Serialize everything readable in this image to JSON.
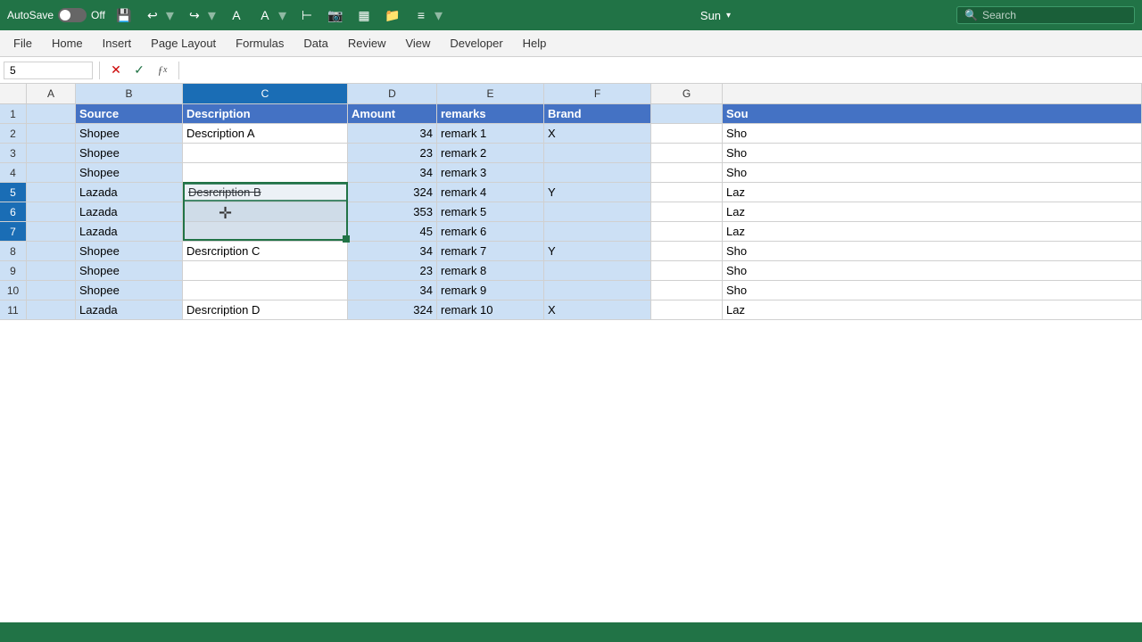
{
  "titleBar": {
    "autosave_label": "AutoSave",
    "toggle_state": "Off",
    "profile": "Sun",
    "search_placeholder": "Search"
  },
  "menuBar": {
    "items": [
      "File",
      "Home",
      "Insert",
      "Page Layout",
      "Formulas",
      "Data",
      "Review",
      "View",
      "Developer",
      "Help"
    ]
  },
  "formulaBar": {
    "cell_ref": "5",
    "formula": ""
  },
  "columns": {
    "letters": [
      "A",
      "B",
      "C",
      "D",
      "E",
      "F",
      "G"
    ],
    "partial_right": "Sou"
  },
  "rows": [
    {
      "num": "1",
      "cells": [
        "",
        "Source",
        "Description",
        "Amount",
        "remarks",
        "Brand",
        ""
      ]
    },
    {
      "num": "2",
      "cells": [
        "",
        "Shopee",
        "Description A",
        "34",
        "remark 1",
        "X",
        "Sho"
      ]
    },
    {
      "num": "3",
      "cells": [
        "",
        "Shopee",
        "",
        "23",
        "remark 2",
        "",
        "Sho"
      ]
    },
    {
      "num": "4",
      "cells": [
        "",
        "Shopee",
        "",
        "34",
        "remark 3",
        "",
        "Sho"
      ]
    },
    {
      "num": "5",
      "cells": [
        "",
        "Lazada",
        "Desrcription B",
        "324",
        "remark 4",
        "Y",
        "Laz"
      ]
    },
    {
      "num": "6",
      "cells": [
        "",
        "Lazada",
        "",
        "353",
        "remark 5",
        "",
        "Laz"
      ]
    },
    {
      "num": "7",
      "cells": [
        "",
        "Lazada",
        "",
        "45",
        "remark 6",
        "",
        "Laz"
      ]
    },
    {
      "num": "8",
      "cells": [
        "",
        "Shopee",
        "Desrcription C",
        "34",
        "remark 7",
        "Y",
        "Sho"
      ]
    },
    {
      "num": "9",
      "cells": [
        "",
        "Shopee",
        "",
        "23",
        "remark 8",
        "",
        "Sho"
      ]
    },
    {
      "num": "10",
      "cells": [
        "",
        "Shopee",
        "",
        "34",
        "remark 9",
        "",
        "Sho"
      ]
    },
    {
      "num": "11",
      "cells": [
        "",
        "Lazada",
        "Desrcription D",
        "324",
        "remark 10",
        "X",
        "Laz"
      ]
    }
  ]
}
